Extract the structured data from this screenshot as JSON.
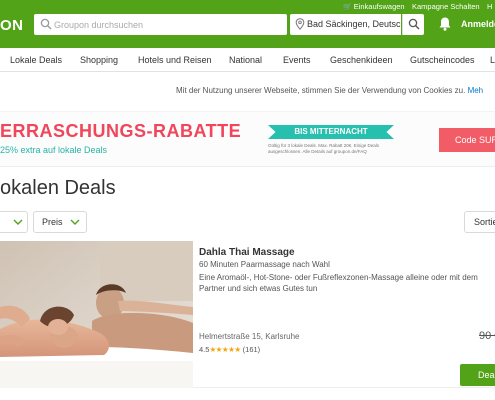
{
  "header": {
    "logo_text": "ON",
    "utility_links": [
      "Einkaufswagen",
      "Kampagne Schalten",
      "H"
    ],
    "search_placeholder": "Groupon durchsuchen",
    "location_value": "Bad Säckingen, Deutsch",
    "login_label": "Anmelden"
  },
  "nav": {
    "items": [
      "Lokale Deals",
      "Shopping",
      "Hotels und Reisen",
      "National",
      "Events",
      "Geschenkideen",
      "Gutscheincodes",
      "L"
    ]
  },
  "cookie_notice": {
    "text": "Mit der Nutzung unserer Webseite, stimmen Sie der Verwendung von Cookies zu.",
    "link_label": "Meh"
  },
  "banner": {
    "title": "ERRASCHUNGS-RABATTE",
    "subtitle": "25% extra auf lokale Deals",
    "pill_label": "BIS MITTERNACHT",
    "fine_print": "Gültig für 3 lokale Deals. Max. Rabatt 20€. Einige Deals ausgeschlossen. Alle Details auf groupon.de/FAQ",
    "code_label": "Code SUR",
    "colors": {
      "title": "#f0455a",
      "accent": "#27bfae"
    }
  },
  "page": {
    "heading": "okalen Deals"
  },
  "filters": {
    "price_label": "Preis",
    "sort_label": "Sortie"
  },
  "deal": {
    "title": "Dahla Thai Massage",
    "subtitle": "60 Minuten Paarmassage nach Wahl",
    "description": "Eine Aromaöl-, Hot-Stone- oder Fußreflexzonen-Massage alleine oder mit dem Partner und sich etwas Gutes tun",
    "address": "Helmertstraße 15, Karlsruhe",
    "rating_value": "4.5",
    "stars": "★★★★★",
    "review_count": "(161)",
    "original_price": "90 €",
    "button_label": "Dea"
  },
  "theme": {
    "brand_green": "#53a318"
  }
}
